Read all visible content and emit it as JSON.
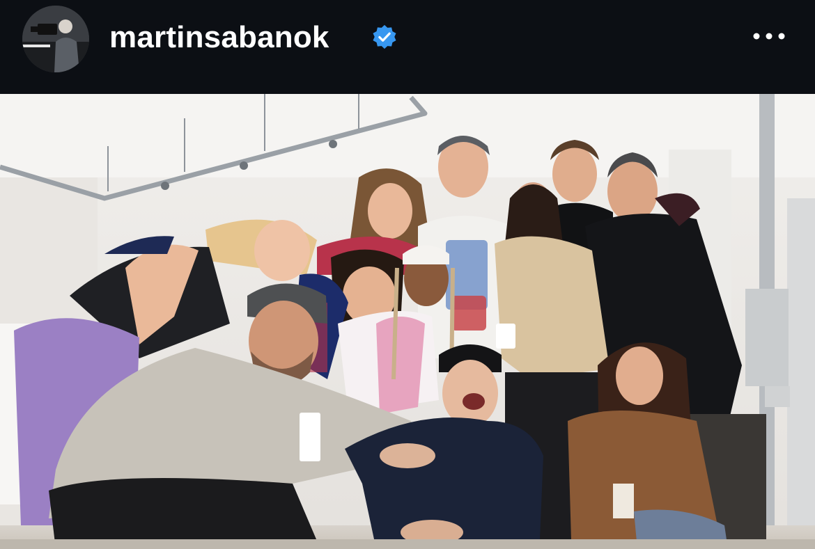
{
  "post": {
    "username": "martinsabanok",
    "verified": true,
    "avatar_icon": "profile-avatar-camera-operator",
    "more_icon": "more-options-ellipsis-icon",
    "verified_icon": "verified-badge-icon"
  },
  "photo": {
    "kind": "group-photo",
    "people_count": 12
  },
  "colors": {
    "header_bg": "#0c0f14",
    "username_text": "#ffffff",
    "verified_blue": "#3797f0"
  }
}
